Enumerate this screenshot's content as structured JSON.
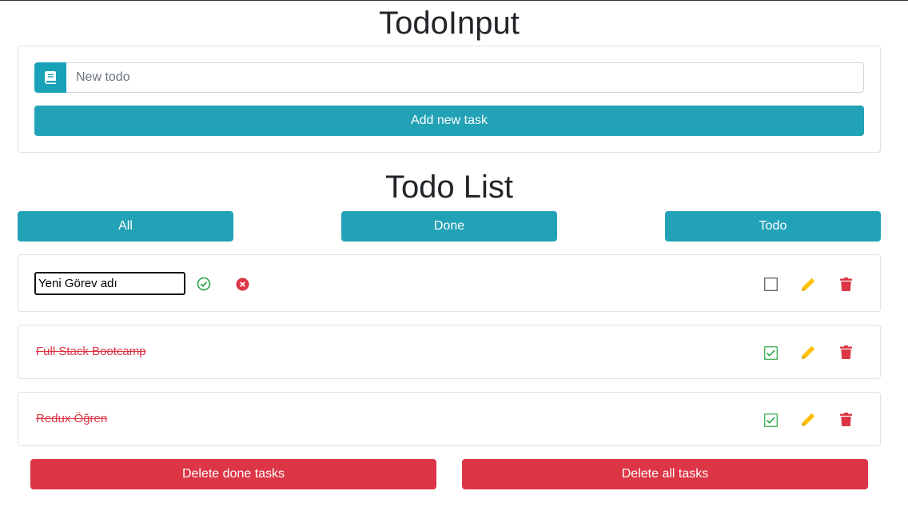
{
  "input_section": {
    "title": "TodoInput",
    "placeholder": "New todo",
    "add_button": "Add new task"
  },
  "list_section": {
    "title": "Todo List",
    "filters": [
      "All",
      "Done",
      "Todo"
    ]
  },
  "todos": [
    {
      "editing": true,
      "edit_value": "Yeni Görev adı",
      "done": false
    },
    {
      "text": "Full Stack Bootcamp",
      "done": true
    },
    {
      "text": "Redux Öğren",
      "done": true
    }
  ],
  "footer": {
    "delete_done": "Delete done tasks",
    "delete_all": "Delete all tasks"
  },
  "colors": {
    "info": "#22a2b7",
    "danger": "#dc3545",
    "success": "#28a745",
    "warning": "#ffc107"
  },
  "icons": [
    "book-icon",
    "check-circle-icon",
    "times-circle-icon",
    "checkbox-icon",
    "pencil-icon",
    "trash-icon"
  ]
}
